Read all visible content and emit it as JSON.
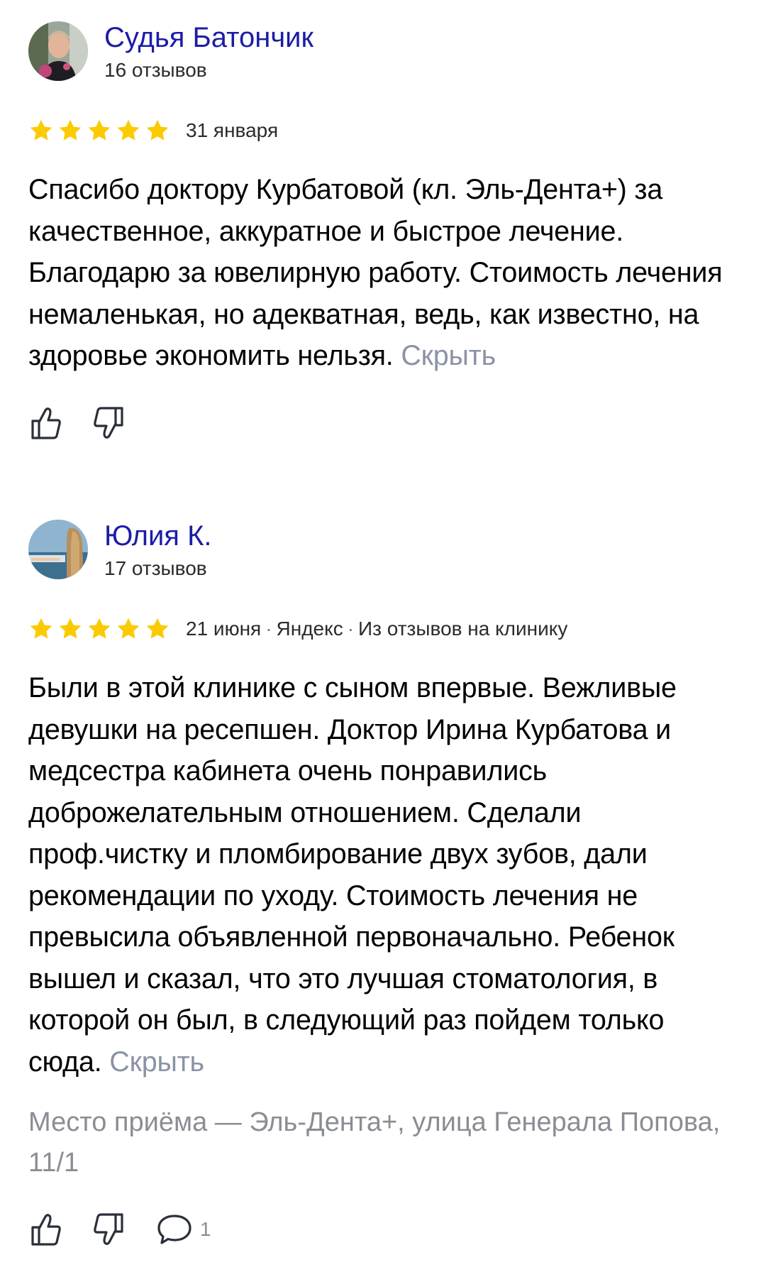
{
  "reviews": [
    {
      "author": "Судья Батончик",
      "reviews_count": "16 отзывов",
      "rating": 5,
      "date": "31 января",
      "text": "Спасибо доктору Курбатовой (кл. Эль-Дента+) за качественное, аккуратное и быстрое лечение. Благодарю за ювелирную работу. Стоимость лечения немаленькая, но адекватная, ведь, как известно, на здоровье экономить нельзя.",
      "hide_label": "Скрыть"
    },
    {
      "author": "Юлия К.",
      "reviews_count": "17 отзывов",
      "rating": 5,
      "date": "21 июня",
      "source": "Яндекс",
      "source_note": "Из отзывов на клинику",
      "text": "Были в этой клинике с сыном впервые. Вежливые девушки на ресепшен. Доктор Ирина Курбатова и медсестра кабинета очень понравились доброжелательным отношением. Сделали проф.чистку и пломбирование двух зубов, дали рекомендации по уходу. Стоимость лечения не превысила объявленной первоначально. Ребенок вышел и сказал, что это лучшая стоматология, в которой он был, в следующий раз пойдем только сюда.",
      "hide_label": "Скрыть",
      "place": "Место приёма — Эль-Дента+, улица Генерала Попова, 11/1",
      "comments_count": "1"
    }
  ],
  "meta_separator": "·",
  "colors": {
    "author": "#1c1ca8",
    "star": "#fcca00",
    "muted": "#8a93a6",
    "icon": "#2a2f3a"
  },
  "icons": [
    "like-icon",
    "dislike-icon",
    "comment-icon",
    "star-icon"
  ]
}
